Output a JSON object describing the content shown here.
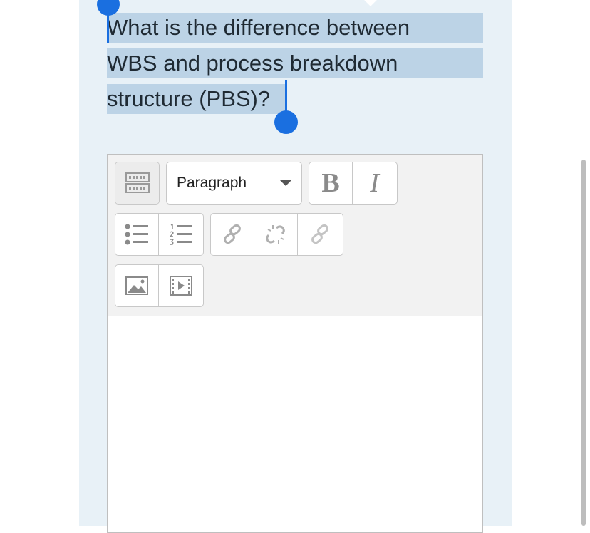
{
  "question": {
    "line1": "What is the difference between",
    "line2": "WBS and process breakdown",
    "line3": "structure (PBS)?"
  },
  "editor": {
    "toolbar": {
      "toggle_icon": "toolbar-toggle-icon",
      "paragraph_select": {
        "selected": "Paragraph"
      },
      "bold_label": "B",
      "italic_label": "I",
      "icons": [
        "unordered-list-icon",
        "ordered-list-icon",
        "link-icon",
        "unlink-icon",
        "manage-files-icon",
        "image-icon",
        "media-icon"
      ]
    }
  },
  "colors": {
    "selection": "#bcd3e6",
    "handle": "#1a6fe0",
    "card_bg": "#e8f1f7",
    "toolbar_bg": "#f2f2f2"
  }
}
